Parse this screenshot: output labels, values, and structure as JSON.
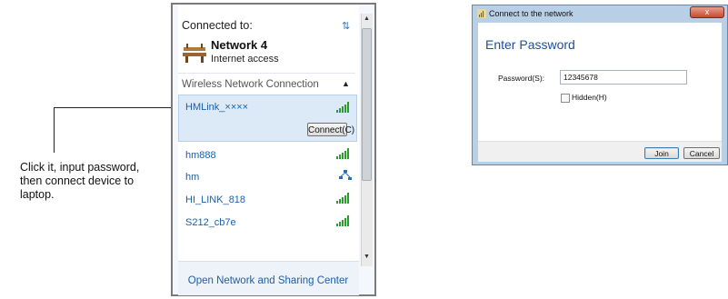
{
  "instruction": {
    "lines": [
      "Click it, input password,",
      "then connect device to",
      "laptop."
    ]
  },
  "flyout": {
    "connected_to": "Connected to:",
    "current_network": {
      "name": "Network 4",
      "status": "Internet access"
    },
    "section_title": "Wireless Network Connection",
    "networks": [
      {
        "name": "HMLink_××××",
        "signal": "signal-bars-icon",
        "selected": true
      },
      {
        "name": "hm888",
        "signal": "signal-bars-icon"
      },
      {
        "name": "hm",
        "signal": "network-nodes-icon"
      },
      {
        "name": "HI_LINK_818",
        "signal": "signal-bars-icon"
      },
      {
        "name": "S212_cb7e",
        "signal": "signal-bars-icon"
      }
    ],
    "connect_button": "Connect(C)",
    "footer_link": "Open Network and Sharing Center"
  },
  "dialog": {
    "window_title": "Connect to the network",
    "close_label": "x",
    "heading": "Enter Password",
    "password_label": "Password(S):",
    "password_value": "12345678",
    "hidden_label": "Hidden(H)",
    "hidden_checked": false,
    "join_label": "Join",
    "cancel_label": "Cancel"
  },
  "colors": {
    "link_blue": "#1c5fa8",
    "heading_blue": "#1f4e94",
    "selection_bg": "#dceaf8",
    "signal_green": "#2e9a2e",
    "close_red": "#c44a30"
  }
}
